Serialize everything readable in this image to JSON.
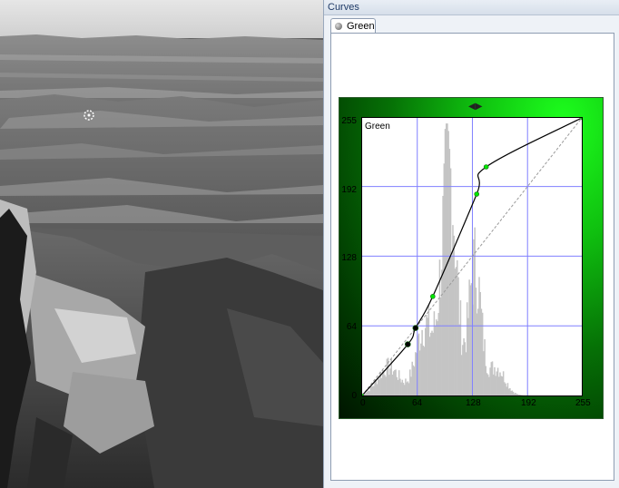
{
  "panel": {
    "title": "Curves"
  },
  "tabs": [
    {
      "label": "Green",
      "icon": "sphere-icon"
    }
  ],
  "curve": {
    "channel_label": "Green",
    "y_ticks": [
      "255",
      "192",
      "128",
      "64",
      "0"
    ],
    "x_ticks": [
      "0",
      "64",
      "128",
      "192",
      "255"
    ],
    "accent_color": "#00e600",
    "grid_color": "#8080ff",
    "points": [
      [
        0,
        0
      ],
      [
        53,
        47
      ],
      [
        62,
        62
      ],
      [
        82,
        91
      ],
      [
        133,
        185
      ],
      [
        144,
        210
      ],
      [
        255,
        255
      ]
    ]
  }
}
